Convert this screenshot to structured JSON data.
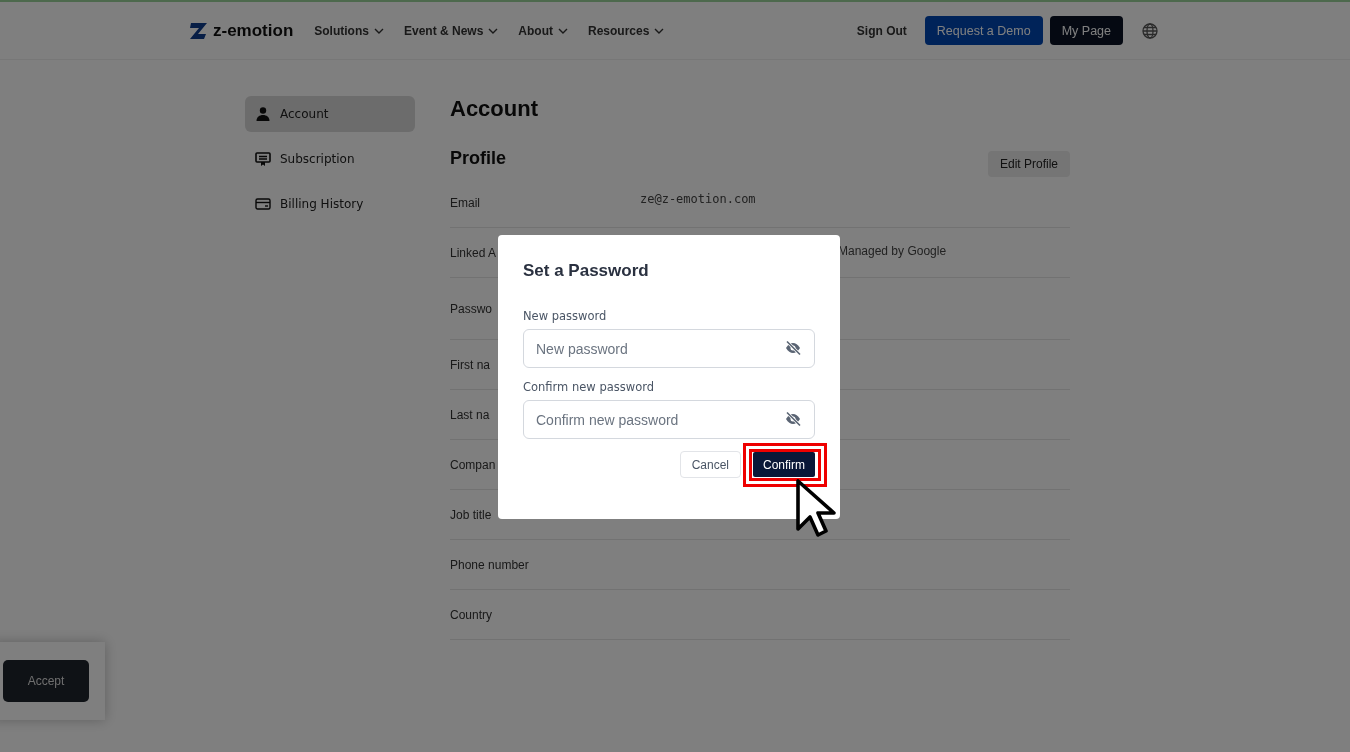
{
  "header": {
    "logo": "z-emotion",
    "nav": [
      {
        "label": "Solutions"
      },
      {
        "label": "Event & News"
      },
      {
        "label": "About"
      },
      {
        "label": "Resources"
      }
    ],
    "sign_out": "Sign Out",
    "demo_button": "Request a Demo",
    "my_page_button": "My Page"
  },
  "sidebar": {
    "items": [
      {
        "label": "Account",
        "selected": true
      },
      {
        "label": "Subscription",
        "selected": false
      },
      {
        "label": "Billing History",
        "selected": false
      }
    ]
  },
  "page_title": "Account",
  "section_title": "Profile",
  "edit_button": "Edit Profile",
  "profile_rows": [
    {
      "label": "Email",
      "value": "ze@z-emotion.com"
    },
    {
      "label": "Linked A",
      "value": "Managed by Google"
    },
    {
      "label": "Passwo"
    },
    {
      "label": "First na"
    },
    {
      "label": "Last na"
    },
    {
      "label": "Compan"
    },
    {
      "label": "Job title"
    },
    {
      "label": "Phone number"
    },
    {
      "label": "Country"
    }
  ],
  "cookie_banner": {
    "accept_button": "Accept"
  },
  "dialog": {
    "title": "Set a Password",
    "fields": [
      {
        "label": "New password",
        "placeholder": "New password"
      },
      {
        "label": "Confirm new password",
        "placeholder": "Confirm new password"
      }
    ],
    "cancel_button": "Cancel",
    "confirm_button": "Confirm",
    "confirm_highlighted": true
  }
}
